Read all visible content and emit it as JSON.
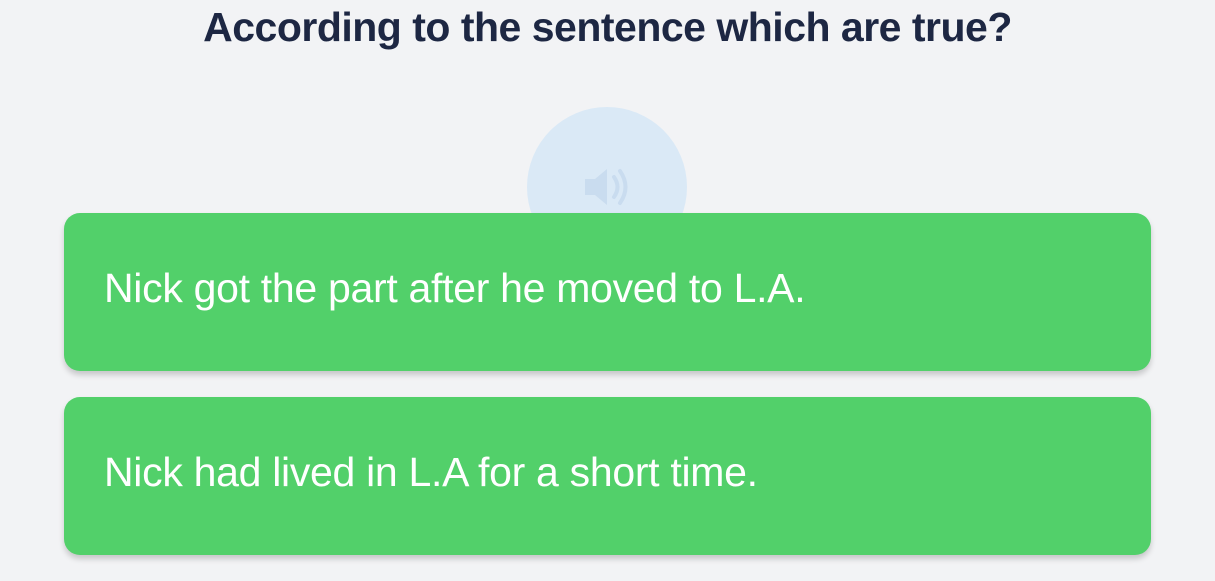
{
  "question": {
    "title": "According to the sentence which are true?"
  },
  "audio": {
    "icon": "speaker-icon"
  },
  "answers": [
    {
      "text": "Nick got the part after he moved to L.A."
    },
    {
      "text": "Nick had lived in L.A for a short time."
    }
  ],
  "colors": {
    "background": "#f2f3f5",
    "title": "#1d2743",
    "answer_background": "#52d06a",
    "answer_text": "#ffffff",
    "audio_button": "#dae9f6"
  }
}
